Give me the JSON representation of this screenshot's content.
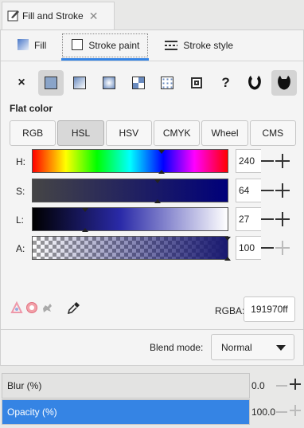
{
  "dock": {
    "tab_label": "Fill and Stroke",
    "close_symbol": "✕"
  },
  "tabs": [
    {
      "label": "Fill",
      "icon": "fill-icon"
    },
    {
      "label": "Stroke paint",
      "icon": "stroke-paint-icon",
      "active": true
    },
    {
      "label": "Stroke style",
      "icon": "stroke-style-icon"
    }
  ],
  "paint_types": [
    "none",
    "flat-color",
    "linear-gradient",
    "radial-gradient",
    "mesh-gradient",
    "pattern",
    "swatch",
    "unset",
    "fill-rule-evenodd",
    "fill-rule-nonzero"
  ],
  "paint_labels": {
    "none": "×",
    "unset": "?"
  },
  "flat_color_label": "Flat color",
  "modes": [
    "RGB",
    "HSL",
    "HSV",
    "CMYK",
    "Wheel",
    "CMS"
  ],
  "active_mode": "HSL",
  "sliders": [
    {
      "label": "H:",
      "value": "240",
      "level": 0.66
    },
    {
      "label": "S:",
      "value": "64",
      "level": 0.64
    },
    {
      "label": "L:",
      "value": "27",
      "level": 0.27
    },
    {
      "label": "A:",
      "value": "100",
      "level": 1.0
    }
  ],
  "rgba": {
    "label": "RGBA:",
    "value": "191970ff"
  },
  "blend": {
    "label": "Blend mode:",
    "value": "Normal"
  },
  "blur": {
    "label": "Blur (%)",
    "value": "0.0",
    "level": 0.0
  },
  "opacity": {
    "label": "Opacity (%)",
    "value": "100.0",
    "level": 1.0
  },
  "colors": {
    "accent": "#3584e4",
    "current": "#191970"
  }
}
